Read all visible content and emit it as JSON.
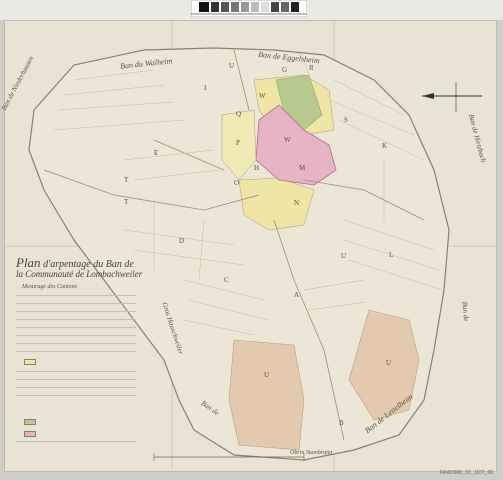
{
  "document_id": "FRAD068_1C_1107_06",
  "legend": {
    "title_line1": "Plan",
    "title_line1_rest": "d'arpentage du Ban de",
    "title_line2": "la Communauté de Lombachweiler",
    "subtitle": "Mesurage des Cantons"
  },
  "border_labels": {
    "top_left": "Ban du Walheim",
    "top_right": "Ban de Eggelsheim",
    "left": "Ban de Niederhausen",
    "right_top": "Ban de Hirtzbach",
    "right_mid": "Ban de",
    "bottom_right": "Ban de Lettelheim",
    "bottom_mid": "Ban de",
    "bottom_small": "Obrin Stambrunn",
    "center_left": "Gros Hauschweiler"
  },
  "parcel_letters": [
    {
      "t": "U"
    },
    {
      "t": "G"
    },
    {
      "t": "R"
    },
    {
      "t": "W"
    },
    {
      "t": "I"
    },
    {
      "t": "Q"
    },
    {
      "t": "P"
    },
    {
      "t": "W"
    },
    {
      "t": "S"
    },
    {
      "t": "K"
    },
    {
      "t": "E"
    },
    {
      "t": "T"
    },
    {
      "t": "T"
    },
    {
      "t": "O"
    },
    {
      "t": "H"
    },
    {
      "t": "M"
    },
    {
      "t": "N"
    },
    {
      "t": "D"
    },
    {
      "t": "C"
    },
    {
      "t": "A"
    },
    {
      "t": "U"
    },
    {
      "t": "L"
    },
    {
      "t": "U"
    },
    {
      "t": "U"
    },
    {
      "t": "B"
    }
  ],
  "colors": {
    "paper": "#e8e3d4",
    "pink": "#e7b9c6",
    "green": "#b9cc90",
    "yellow": "#efe7a6",
    "tan": "#e6cdb3",
    "line": "#a79a88"
  }
}
